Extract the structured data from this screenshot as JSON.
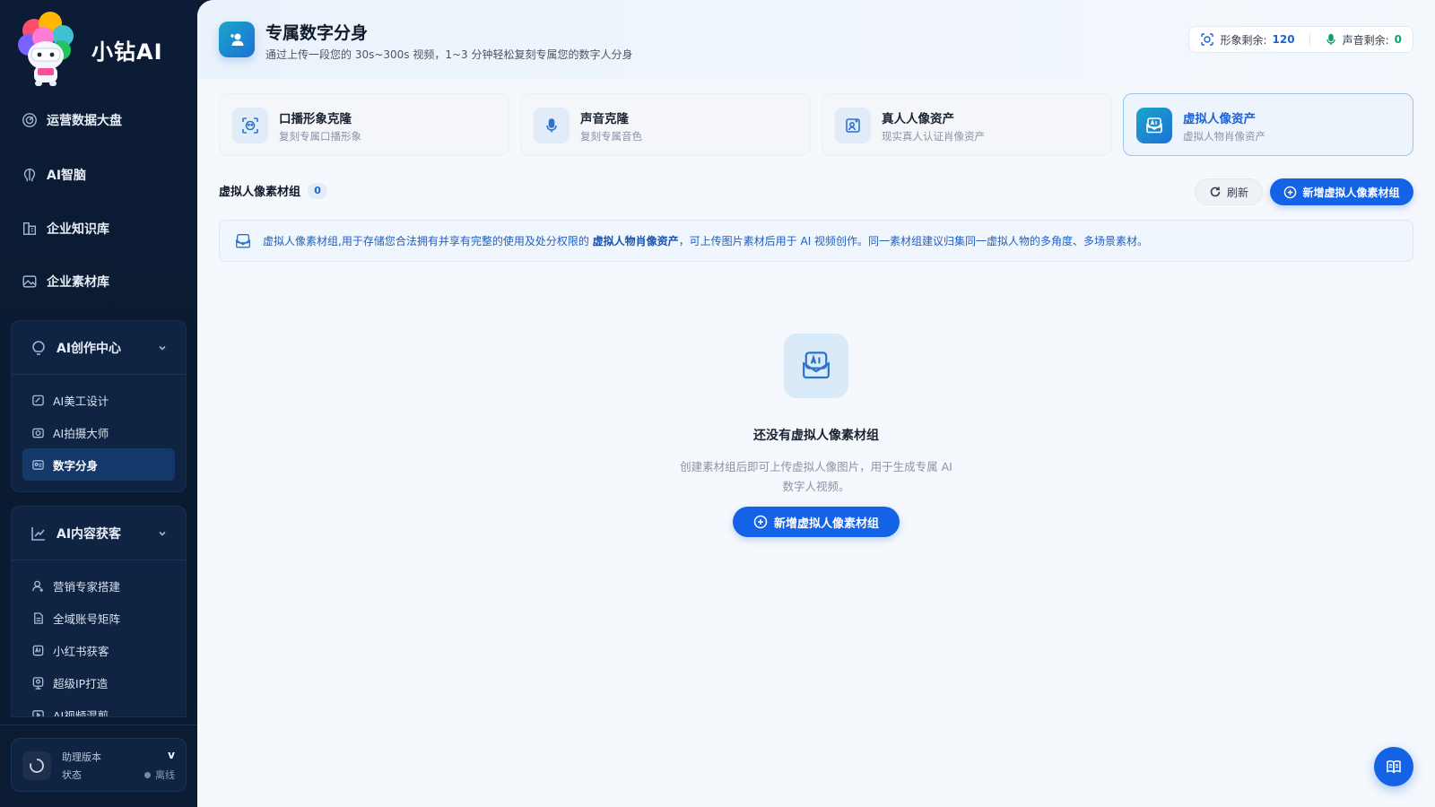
{
  "sidebar": {
    "brand": "小钻AI",
    "logo_badge": "小钻AI",
    "nav": [
      {
        "label": "运营数据大盘",
        "icon": "dashboard-icon"
      },
      {
        "label": "AI智脑",
        "icon": "brain-icon"
      },
      {
        "label": "企业知识库",
        "icon": "knowledge-icon"
      },
      {
        "label": "企业素材库",
        "icon": "image-icon"
      }
    ],
    "groups": [
      {
        "title": "AI创作中心",
        "items": [
          {
            "label": "AI美工设计",
            "active": false
          },
          {
            "label": "AI拍摄大师",
            "active": false
          },
          {
            "label": "数字分身",
            "active": true
          }
        ]
      },
      {
        "title": "AI内容获客",
        "items": [
          {
            "label": "营销专家搭建"
          },
          {
            "label": "全域账号矩阵"
          },
          {
            "label": "小红书获客"
          },
          {
            "label": "超级IP打造"
          },
          {
            "label": "AI视频混剪"
          }
        ]
      }
    ],
    "status": {
      "label1": "助理版本",
      "label2": "状态",
      "version": "v",
      "state": "离线"
    }
  },
  "header": {
    "title": "专属数字分身",
    "subtitle": "通过上传一段您的 30s~300s 视频，1~3 分钟轻松复刻专属您的数字人分身",
    "quota_image_label": "形象剩余:",
    "quota_image_value": "120",
    "quota_voice_label": "声音剩余:",
    "quota_voice_value": "0"
  },
  "cards": [
    {
      "title": "口播形象克隆",
      "subtitle": "复刻专属口播形象",
      "active": false
    },
    {
      "title": "声音克隆",
      "subtitle": "复刻专属音色",
      "active": false
    },
    {
      "title": "真人人像资产",
      "subtitle": "现实真人认证肖像资产",
      "active": false
    },
    {
      "title": "虚拟人像资产",
      "subtitle": "虚拟人物肖像资产",
      "active": true
    }
  ],
  "section": {
    "title": "虚拟人像素材组",
    "count": "0",
    "refresh_label": "刷新",
    "add_label": "新增虚拟人像素材组"
  },
  "notice": {
    "before": "虚拟人像素材组,用于存储您合法拥有并享有完整的使用及处分权限的",
    "highlight": "虚拟人物肖像资产",
    "after": "，可上传图片素材后用于 AI 视频创作。同一素材组建议归集同一虚拟人物的多角度、多场景素材。"
  },
  "empty": {
    "title": "还没有虚拟人像素材组",
    "desc": "创建素材组后即可上传虚拟人像图片，用于生成专属 AI 数字人视频。",
    "button": "新增虚拟人像素材组"
  },
  "colors": {
    "primary": "#1463e6",
    "sidebar_bg": "#0c1c36",
    "accent_green": "#0f9f72"
  }
}
